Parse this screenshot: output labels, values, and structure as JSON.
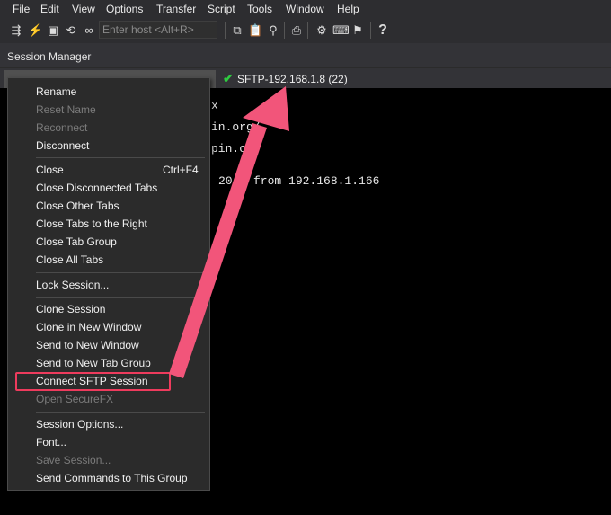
{
  "menubar": [
    "File",
    "Edit",
    "View",
    "Options",
    "Transfer",
    "Script",
    "Tools",
    "Window",
    "Help"
  ],
  "toolbar": {
    "host_placeholder": "Enter host <Alt+R>",
    "icons": [
      "connect-icon",
      "quick-connect-icon",
      "console-icon",
      "reconnect-icon",
      "link-icon",
      "copy-icon",
      "paste-icon",
      "find-icon",
      "print-icon",
      "settings-icon",
      "keymap-icon",
      "sftp-icon",
      "help-icon"
    ]
  },
  "session_manager": {
    "label": "Session Manager"
  },
  "tabs": [
    {
      "label": "SFTP-192.168.1.8 (22)",
      "status": "connected"
    }
  ],
  "terminal": {
    "lines": [
      "x",
      "in.org/",
      "pin.or",
      "20   from 192.168.1.166"
    ]
  },
  "context_menu": {
    "groups": [
      [
        {
          "label": "Rename",
          "disabled": false
        },
        {
          "label": "Reset Name",
          "disabled": true
        },
        {
          "label": "Reconnect",
          "disabled": true
        },
        {
          "label": "Disconnect",
          "disabled": false
        }
      ],
      [
        {
          "label": "Close",
          "shortcut": "Ctrl+F4",
          "disabled": false
        },
        {
          "label": "Close Disconnected Tabs",
          "disabled": false
        },
        {
          "label": "Close Other Tabs",
          "disabled": false
        },
        {
          "label": "Close Tabs to the Right",
          "disabled": false
        },
        {
          "label": "Close Tab Group",
          "disabled": false
        },
        {
          "label": "Close All Tabs",
          "disabled": false
        }
      ],
      [
        {
          "label": "Lock Session...",
          "disabled": false
        }
      ],
      [
        {
          "label": "Clone Session",
          "disabled": false
        },
        {
          "label": "Clone in New Window",
          "disabled": false
        },
        {
          "label": "Send to New Window",
          "disabled": false
        },
        {
          "label": "Send to New Tab Group",
          "disabled": false
        },
        {
          "label": "Connect SFTP Session",
          "disabled": false,
          "highlighted": true
        },
        {
          "label": "Open SecureFX",
          "disabled": true
        }
      ],
      [
        {
          "label": "Session Options...",
          "disabled": false
        },
        {
          "label": "Font...",
          "disabled": false
        },
        {
          "label": "Save Session...",
          "disabled": true
        },
        {
          "label": "Send Commands to This Group",
          "disabled": false
        }
      ]
    ]
  },
  "colors": {
    "highlight_box": "#ee3b5d",
    "arrow": "#f2557a",
    "status_ok": "#2ecc40"
  }
}
